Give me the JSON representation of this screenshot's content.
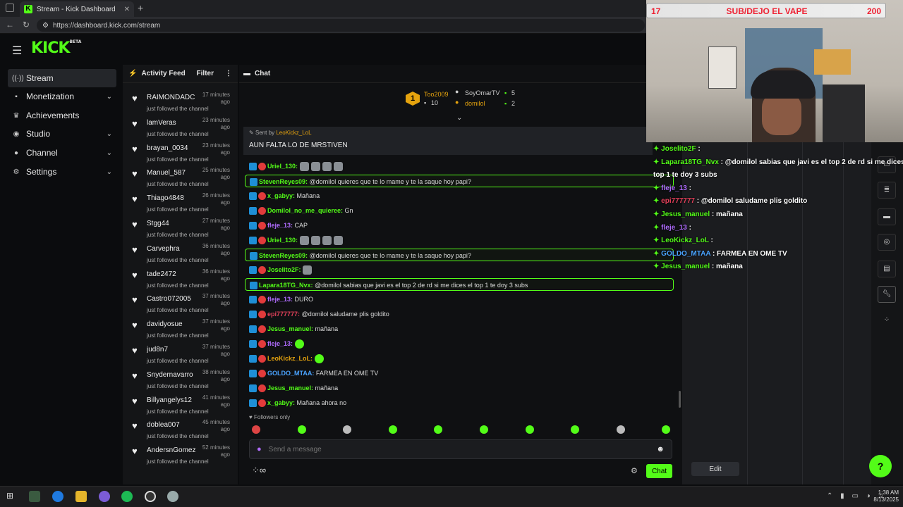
{
  "browser": {
    "tab_title": "Stream - Kick Dashboard",
    "url": "https://dashboard.kick.com/stream"
  },
  "header": {
    "logo": "KICK",
    "logo_tag": "BETA"
  },
  "sidebar": {
    "items": [
      {
        "label": "Stream",
        "icon": "broadcast-icon"
      },
      {
        "label": "Monetization",
        "icon": "dollar-icon"
      },
      {
        "label": "Achievements",
        "icon": "trophy-icon"
      },
      {
        "label": "Studio",
        "icon": "studio-icon"
      },
      {
        "label": "Channel",
        "icon": "user-icon"
      },
      {
        "label": "Settings",
        "icon": "gear-icon"
      }
    ]
  },
  "feed": {
    "title": "Activity Feed",
    "filter": "Filter",
    "items": [
      {
        "name": "RAIMONDADC",
        "time": "17 minutes ago",
        "action": "just followed the channel"
      },
      {
        "name": "lamVeras",
        "time": "23 minutes ago",
        "action": "just followed the channel"
      },
      {
        "name": "brayan_0034",
        "time": "23 minutes ago",
        "action": "just followed the channel"
      },
      {
        "name": "Manuel_587",
        "time": "25 minutes ago",
        "action": "just followed the channel"
      },
      {
        "name": "Thiago4848",
        "time": "26 minutes ago",
        "action": "just followed the channel"
      },
      {
        "name": "Stgg44",
        "time": "27 minutes ago",
        "action": "just followed the channel"
      },
      {
        "name": "Carvephra",
        "time": "36 minutes ago",
        "action": "just followed the channel"
      },
      {
        "name": "tade2472",
        "time": "36 minutes ago",
        "action": "just followed the channel"
      },
      {
        "name": "Castro072005",
        "time": "37 minutes ago",
        "action": "just followed the channel"
      },
      {
        "name": "davidyosue",
        "time": "37 minutes ago",
        "action": "just followed the channel"
      },
      {
        "name": "jud8n7",
        "time": "37 minutes ago",
        "action": "just followed the channel"
      },
      {
        "name": "Snydernavarro",
        "time": "38 minutes ago",
        "action": "just followed the channel"
      },
      {
        "name": "Billyangelys12",
        "time": "41 minutes ago",
        "action": "just followed the channel"
      },
      {
        "name": "doblea007",
        "time": "45 minutes ago",
        "action": "just followed the channel"
      },
      {
        "name": "AndersnGomez",
        "time": "52 minutes ago",
        "action": "just followed the channel"
      }
    ]
  },
  "chat": {
    "title": "Chat",
    "leaderboard": {
      "rank": "1",
      "first_name": "Too2009",
      "first_count": "10",
      "second_name": "SoyOmarTV",
      "second_count": "5",
      "third_name": "domilol",
      "third_count": "2"
    },
    "pinned": {
      "sent_by": "Sent by",
      "author": "LeoKickz_LoL",
      "message": "AUN FALTA LO DE MRSTIVEN"
    },
    "messages": [
      {
        "user": "Uriel_130:",
        "color": "#53fc18",
        "text": "",
        "emotes": 4,
        "hl": false
      },
      {
        "user": "StevenReyes09:",
        "color": "#53fc18",
        "text": "@domilol quieres que te lo mame y te la saque hoy papi?",
        "emotes": 0,
        "hl": true
      },
      {
        "user": "x_gabyy:",
        "color": "#53fc18",
        "text": "Mañana",
        "emotes": 0,
        "hl": false
      },
      {
        "user": "Domilol_no_me_quieree:",
        "color": "#53fc18",
        "text": "Gn",
        "emotes": 0,
        "hl": false
      },
      {
        "user": "fleje_13:",
        "color": "#b06cff",
        "text": "CAP",
        "emotes": 0,
        "hl": false
      },
      {
        "user": "Uriel_130:",
        "color": "#53fc18",
        "text": "",
        "emotes": 4,
        "hl": false
      },
      {
        "user": "StevenReyes09:",
        "color": "#53fc18",
        "text": "@domilol quieres que te lo mame y te la saque hoy papi?",
        "emotes": 0,
        "hl": true
      },
      {
        "user": "Joselito2F:",
        "color": "#53fc18",
        "text": "",
        "emotes": 1,
        "hl": false
      },
      {
        "user": "Lapara18TG_Nvx:",
        "color": "#53fc18",
        "text": "@domilol sabias que javi es el top 2 de rd si me dices el top 1 te doy 3 subs",
        "emotes": 0,
        "hl": true
      },
      {
        "user": "fleje_13:",
        "color": "#b06cff",
        "text": "DURO",
        "emotes": 0,
        "hl": false
      },
      {
        "user": "epi777777:",
        "color": "#e2405a",
        "text": "@domilol saludame plis goldito",
        "emotes": 0,
        "hl": false
      },
      {
        "user": "Jesus_manuel:",
        "color": "#53fc18",
        "text": "mañana",
        "emotes": 0,
        "hl": false
      },
      {
        "user": "fleje_13:",
        "color": "#b06cff",
        "text": "",
        "emotes": 1,
        "hl": false
      },
      {
        "user": "LeoKickz_LoL:",
        "color": "#e5a30e",
        "text": "",
        "emotes": 1,
        "hl": false
      },
      {
        "user": "GOLDO_MTAA:",
        "color": "#4aa3ff",
        "text": "FARMEA EN OME TV",
        "emotes": 0,
        "hl": false
      },
      {
        "user": "Jesus_manuel:",
        "color": "#53fc18",
        "text": "mañana",
        "emotes": 0,
        "hl": false
      },
      {
        "user": "x_gabyy:",
        "color": "#53fc18",
        "text": "Mañana ahora no",
        "emotes": 0,
        "hl": false
      }
    ],
    "followers_only": "Followers only",
    "input_placeholder": "Send a message",
    "send_label": "Chat"
  },
  "overlay": {
    "goal_left": "17",
    "goal_title": "SUB/DEJO EL VAPE",
    "goal_right": "200",
    "messages": [
      {
        "user": "Joselito2F",
        "color": "#53fc18",
        "text": " : "
      },
      {
        "user": "Lapara18TG_Nvx",
        "color": "#53fc18",
        "text": " : @domilol sabias que javi es el top 2 de rd si me dices"
      },
      {
        "user": "",
        "color": "#fff",
        "text": "top 1 te doy 3 subs"
      },
      {
        "user": "fleje_13",
        "color": "#b06cff",
        "text": " : "
      },
      {
        "user": "epi777777",
        "color": "#e2405a",
        "text": " : @domilol saludame plis goldito"
      },
      {
        "user": "Jesus_manuel",
        "color": "#53fc18",
        "text": " : mañana"
      },
      {
        "user": "fleje_13",
        "color": "#b06cff",
        "text": " : "
      },
      {
        "user": "LeoKickz_LoL",
        "color": "#53fc18",
        "text": " : "
      },
      {
        "user": "GOLDO_MTAA",
        "color": "#4aa3ff",
        "text": " : FARMEA EN OME TV"
      },
      {
        "user": "Jesus_manuel",
        "color": "#53fc18",
        "text": " : mañana"
      }
    ]
  },
  "right_panel": {
    "edit_label": "Edit"
  },
  "taskbar": {
    "time": "1:38 AM",
    "date": "8/13/2025"
  },
  "colors": {
    "accent": "#53fc18",
    "background": "#0b0c0e"
  }
}
